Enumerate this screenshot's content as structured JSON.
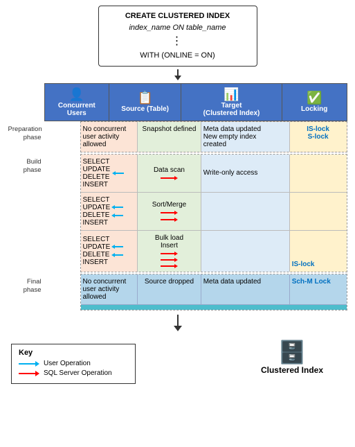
{
  "sql": {
    "line1": "CREATE CLUSTERED INDEX",
    "line2": "index_name ON table_name",
    "dots": ":",
    "line3": "WITH (ONLINE = ON)"
  },
  "header": {
    "cols": [
      {
        "label": "Concurrent\nUsers",
        "icon": "👤"
      },
      {
        "label": "Source (Table)",
        "icon": "🗂️"
      },
      {
        "label": "Target\n(Clustered Index)",
        "icon": "📋"
      },
      {
        "label": "Locking",
        "icon": "✅"
      }
    ]
  },
  "phases": {
    "preparation": {
      "label": "Preparation\nphase",
      "concurrent": "No concurrent\nuser activity\nallowed",
      "source": "Snapshot\ndefined",
      "target": "Meta data updated\nNew empty index\ncreated",
      "locking": "IS-lock\nS-lock"
    },
    "build": {
      "label": "Build\nphase",
      "rows": [
        {
          "concurrent": "SELECT\nUPDATE\nDELETE\nINSERT",
          "source": "Data scan",
          "target": "Write-only access",
          "locking": ""
        },
        {
          "concurrent": "SELECT\nUPDATE\nDELETE\nINSERT",
          "source": "Sort/Merge",
          "target": "",
          "locking": ""
        },
        {
          "concurrent": "SELECT\nUPDATE\nDELETE\nINSERT",
          "source": "Bulk load\nInsert",
          "target": "",
          "locking": "IS-lock"
        }
      ]
    },
    "final": {
      "label": "Final\nphase",
      "concurrent": "No concurrent\nuser activity\nallowed",
      "source": "Source dropped",
      "target": "Meta data updated",
      "locking": "Sch-M Lock"
    }
  },
  "key": {
    "title": "Key",
    "items": [
      {
        "color": "blue",
        "label": "User Operation"
      },
      {
        "color": "red",
        "label": "SQL Server Operation"
      }
    ]
  },
  "bottom": {
    "label": "Clustered Index"
  }
}
